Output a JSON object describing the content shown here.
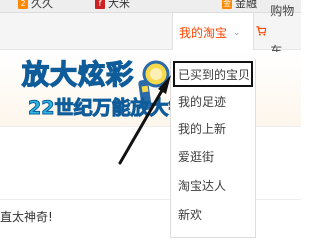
{
  "bookmarks": [
    {
      "label": "久久",
      "icon": "bookmark-2-icon",
      "color": "#ff8800"
    },
    {
      "label": "大米",
      "icon": "bookmark-red-icon",
      "color": "#cc2222"
    },
    {
      "label": "金融",
      "icon": "bookmark-gold-icon",
      "color": "#ff8800"
    }
  ],
  "nav": {
    "my_taobao": "我的淘宝",
    "cart_label": "购物车"
  },
  "banner": {
    "headline": "放大炫彩",
    "subline": "22世纪万能放大镜"
  },
  "dropdown": {
    "items": [
      "已买到的宝贝",
      "我的足迹",
      "我的上新",
      "爱逛街",
      "淘宝达人",
      "新欢"
    ]
  },
  "promo": {
    "text": "直太神奇!"
  },
  "colors": {
    "accent": "#ff4400",
    "annotation": "#111111"
  }
}
